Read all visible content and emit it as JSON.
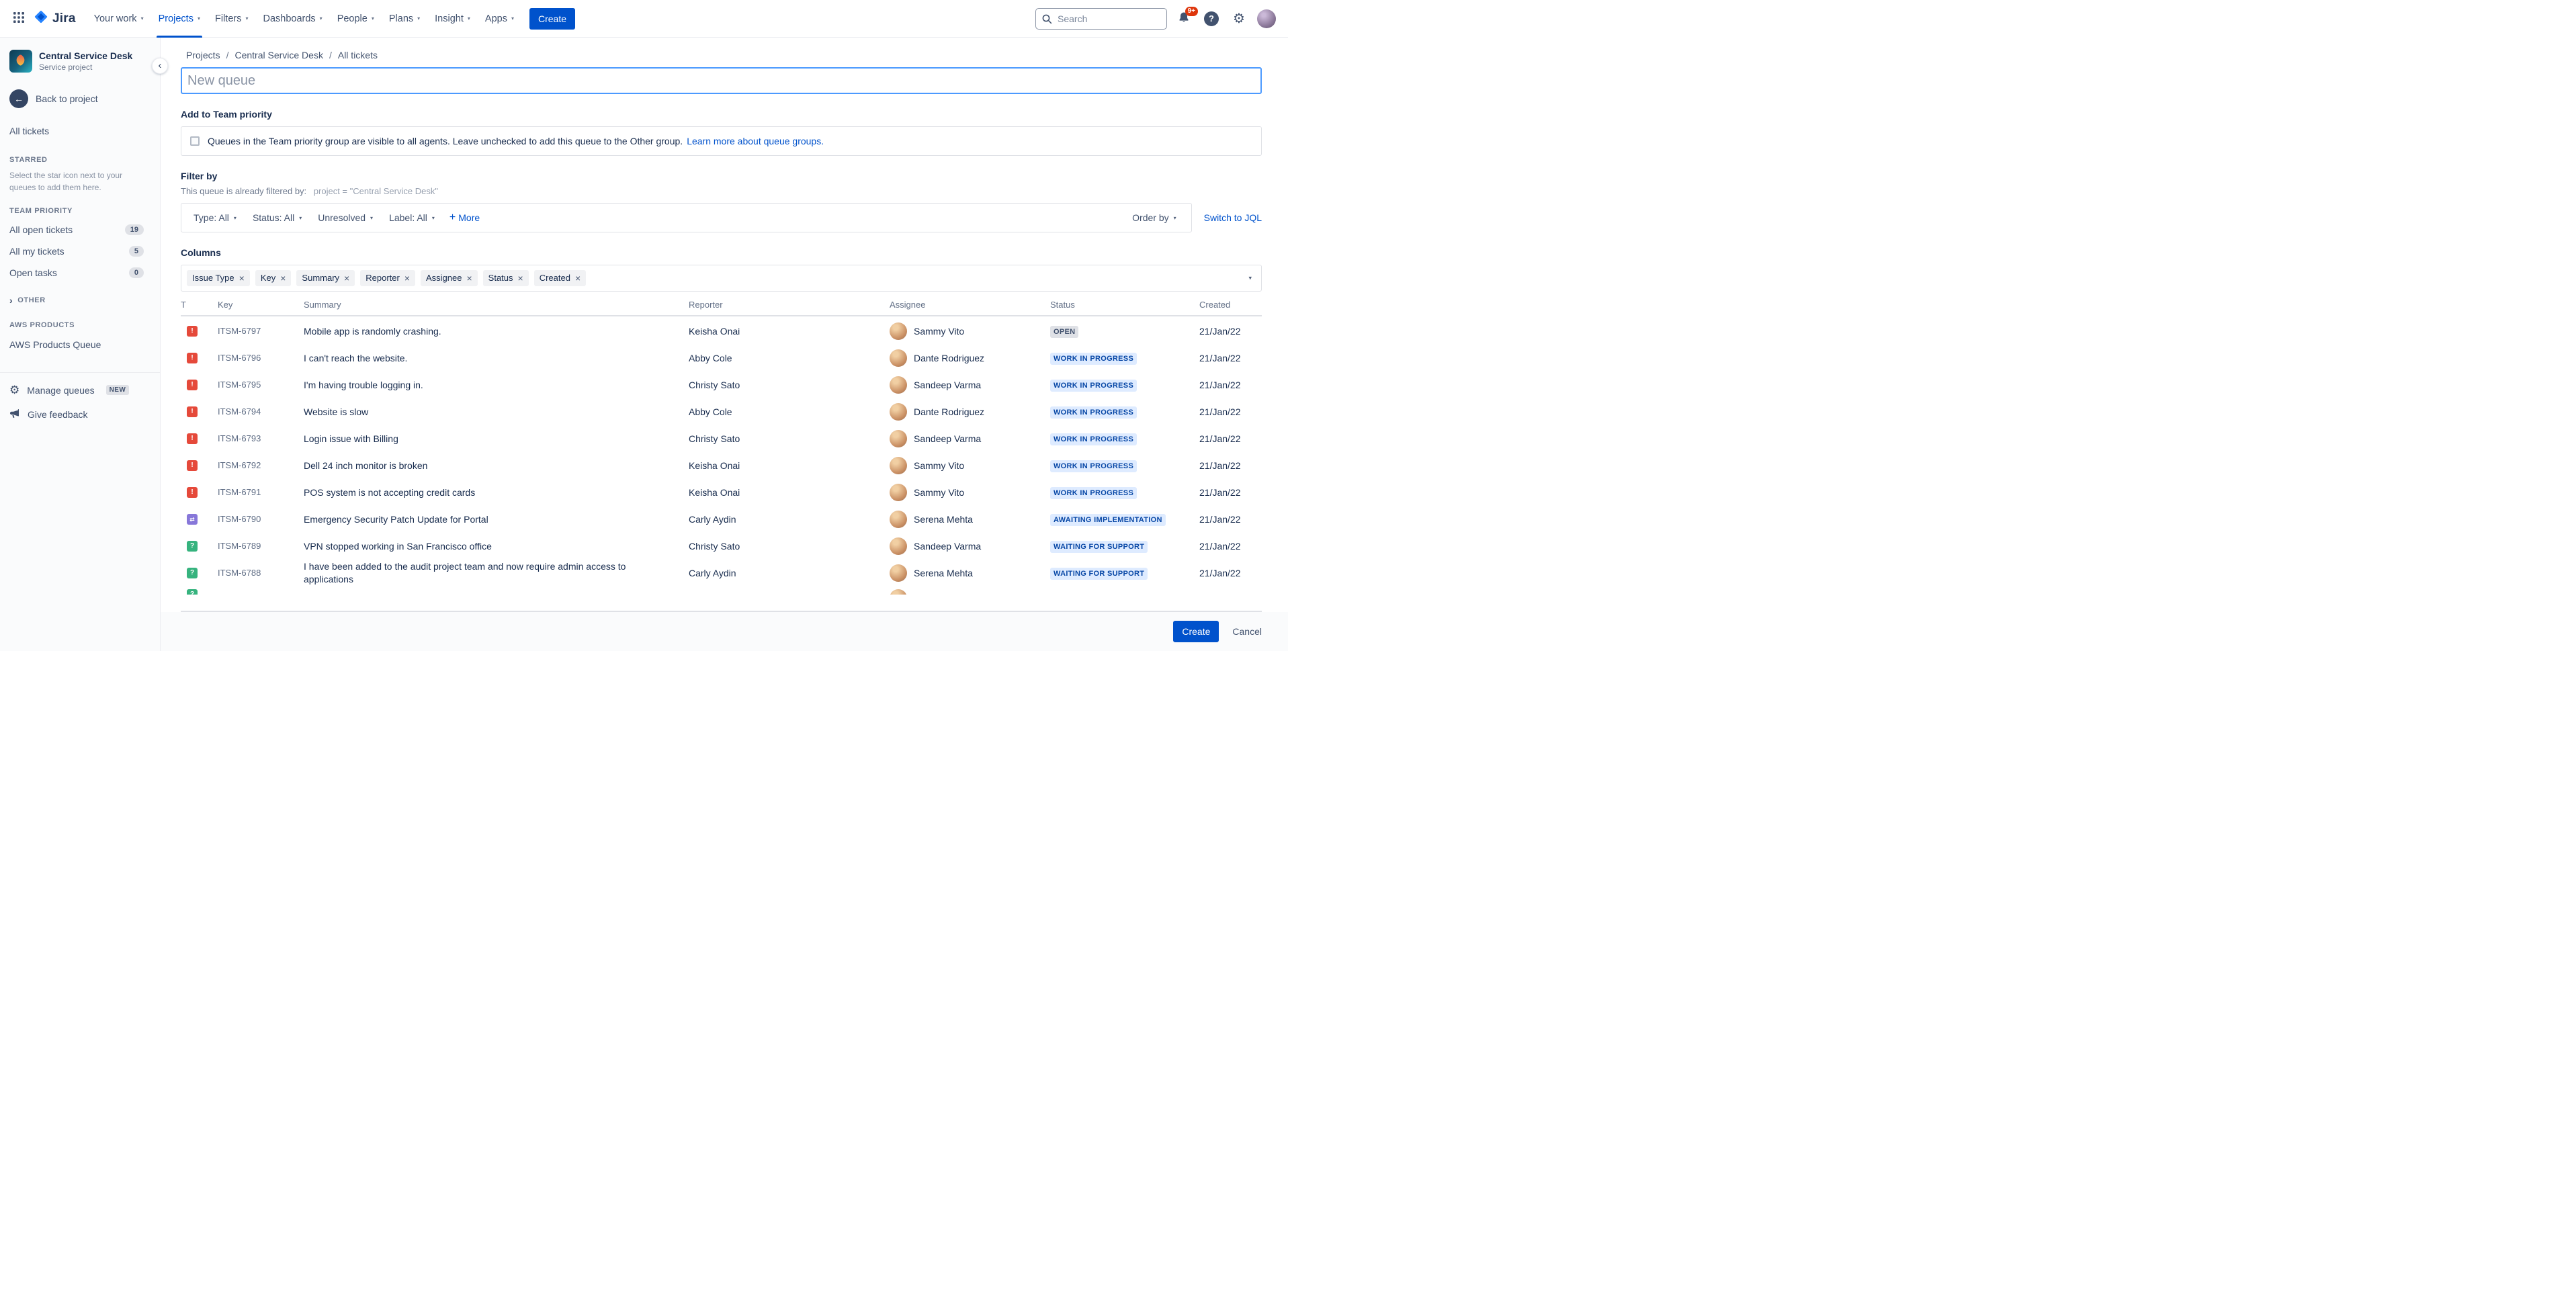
{
  "topnav": {
    "logo_text": "Jira",
    "items": [
      {
        "label": "Your work"
      },
      {
        "label": "Projects",
        "active": true
      },
      {
        "label": "Filters"
      },
      {
        "label": "Dashboards"
      },
      {
        "label": "People"
      },
      {
        "label": "Plans"
      },
      {
        "label": "Insight"
      },
      {
        "label": "Apps"
      }
    ],
    "create_label": "Create",
    "search_placeholder": "Search",
    "notifications_badge": "9+"
  },
  "sidebar": {
    "project_name": "Central Service Desk",
    "project_type": "Service project",
    "back_label": "Back to project",
    "all_tickets_label": "All tickets",
    "starred_header": "STARRED",
    "starred_hint": "Select the star icon next to your queues to add them here.",
    "team_priority_header": "TEAM PRIORITY",
    "team_items": [
      {
        "label": "All open tickets",
        "count": "19"
      },
      {
        "label": "All my tickets",
        "count": "5"
      },
      {
        "label": "Open tasks",
        "count": "0"
      }
    ],
    "other_header": "OTHER",
    "aws_header": "AWS PRODUCTS",
    "aws_queue_label": "AWS Products Queue",
    "manage_queues_label": "Manage queues",
    "manage_queues_badge": "NEW",
    "give_feedback_label": "Give feedback"
  },
  "main": {
    "breadcrumb": [
      "Projects",
      "Central Service Desk",
      "All tickets"
    ],
    "queue_name_placeholder": "New queue",
    "team_priority": {
      "heading": "Add to Team priority",
      "checkbox_text": "Queues in the Team priority group are visible to all agents. Leave unchecked to add this queue to the Other group.",
      "link_label": "Learn more about queue groups."
    },
    "filter": {
      "heading": "Filter by",
      "prefilter_label": "This queue is already filtered by:",
      "prefilter_value": "project = \"Central Service Desk\"",
      "dropdowns": [
        "Type: All",
        "Status: All",
        "Unresolved",
        "Label: All"
      ],
      "more_label": "More",
      "order_by_label": "Order by",
      "switch_jql_label": "Switch to JQL"
    },
    "columns_heading": "Columns",
    "column_chips": [
      "Issue Type",
      "Key",
      "Summary",
      "Reporter",
      "Assignee",
      "Status",
      "Created"
    ],
    "table": {
      "headers": [
        "T",
        "Key",
        "Summary",
        "Reporter",
        "Assignee",
        "Status",
        "Created"
      ],
      "rows": [
        {
          "type": "incident",
          "key": "ITSM-6797",
          "summary": "Mobile app is randomly crashing.",
          "reporter": "Keisha Onai",
          "assignee": "Sammy Vito",
          "status": "OPEN",
          "status_type": "gray",
          "created": "21/Jan/22"
        },
        {
          "type": "incident",
          "key": "ITSM-6796",
          "summary": "I can't reach the website.",
          "reporter": "Abby Cole",
          "assignee": "Dante Rodriguez",
          "status": "WORK IN PROGRESS",
          "status_type": "blue",
          "created": "21/Jan/22"
        },
        {
          "type": "incident",
          "key": "ITSM-6795",
          "summary": "I'm having trouble logging in.",
          "reporter": "Christy Sato",
          "assignee": "Sandeep Varma",
          "status": "WORK IN PROGRESS",
          "status_type": "blue",
          "created": "21/Jan/22"
        },
        {
          "type": "incident",
          "key": "ITSM-6794",
          "summary": "Website is slow",
          "reporter": "Abby Cole",
          "assignee": "Dante Rodriguez",
          "status": "WORK IN PROGRESS",
          "status_type": "blue",
          "created": "21/Jan/22"
        },
        {
          "type": "incident",
          "key": "ITSM-6793",
          "summary": "Login issue with Billing",
          "reporter": "Christy Sato",
          "assignee": "Sandeep Varma",
          "status": "WORK IN PROGRESS",
          "status_type": "blue",
          "created": "21/Jan/22"
        },
        {
          "type": "incident",
          "key": "ITSM-6792",
          "summary": "Dell 24 inch monitor is broken",
          "reporter": "Keisha Onai",
          "assignee": "Sammy Vito",
          "status": "WORK IN PROGRESS",
          "status_type": "blue",
          "created": "21/Jan/22"
        },
        {
          "type": "incident",
          "key": "ITSM-6791",
          "summary": "POS system is not accepting credit cards",
          "reporter": "Keisha Onai",
          "assignee": "Sammy Vito",
          "status": "WORK IN PROGRESS",
          "status_type": "blue",
          "created": "21/Jan/22"
        },
        {
          "type": "change",
          "key": "ITSM-6790",
          "summary": "Emergency Security Patch Update for Portal",
          "reporter": "Carly Aydin",
          "assignee": "Serena Mehta",
          "status": "AWAITING IMPLEMENTATION",
          "status_type": "blue",
          "created": "21/Jan/22"
        },
        {
          "type": "request",
          "key": "ITSM-6789",
          "summary": "VPN stopped working in San Francisco office",
          "reporter": "Christy Sato",
          "assignee": "Sandeep Varma",
          "status": "WAITING FOR SUPPORT",
          "status_type": "blue",
          "created": "21/Jan/22"
        },
        {
          "type": "request",
          "key": "ITSM-6788",
          "summary": "I have been added to the audit project team and now require admin access to applications",
          "reporter": "Carly Aydin",
          "assignee": "Serena Mehta",
          "status": "WAITING FOR SUPPORT",
          "status_type": "blue",
          "created": "21/Jan/22"
        }
      ]
    }
  },
  "footer": {
    "create_label": "Create",
    "cancel_label": "Cancel"
  }
}
